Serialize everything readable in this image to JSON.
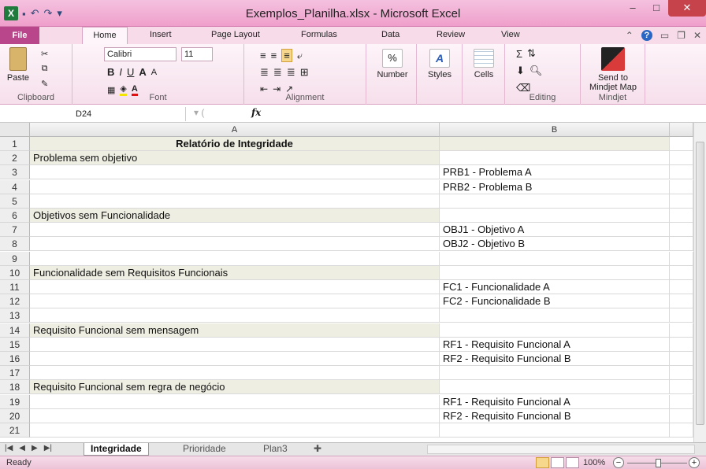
{
  "window": {
    "title": "Exemplos_Planilha.xlsx - Microsoft Excel",
    "app_icon": "X",
    "minimize": "–",
    "maximize": "□",
    "close": "✕"
  },
  "ribbon_tabs": [
    "File",
    "Home",
    "Insert",
    "Page Layout",
    "Formulas",
    "Data",
    "Review",
    "View"
  ],
  "ribbon": {
    "clipboard": {
      "paste": "Paste",
      "label": "Clipboard"
    },
    "font": {
      "name": "Calibri",
      "size": "11",
      "bold": "B",
      "italic": "I",
      "underline": "U",
      "grow": "A",
      "shrink": "A",
      "color": "A",
      "label": "Font"
    },
    "alignment": {
      "label": "Alignment"
    },
    "number": {
      "button": "Number",
      "symbol": "%"
    },
    "styles": {
      "button": "Styles"
    },
    "cells": {
      "button": "Cells"
    },
    "editing": {
      "label": "Editing",
      "sum": "Σ"
    },
    "mindjet": {
      "button_line1": "Send to",
      "button_line2": "Mindjet Map",
      "label": "Mindjet"
    }
  },
  "formula_bar": {
    "name_box": "D24",
    "fx": "fx",
    "content": ""
  },
  "columns": [
    "A",
    "B"
  ],
  "rows": [
    {
      "n": "1",
      "a": "Relatório de Integridade",
      "b": "",
      "type": "title"
    },
    {
      "n": "2",
      "a": "Problema sem objetivo",
      "b": "",
      "type": "section"
    },
    {
      "n": "3",
      "a": "",
      "b": "PRB1 - Problema A",
      "type": "item"
    },
    {
      "n": "4",
      "a": "",
      "b": "PRB2 - Problema B",
      "type": "item"
    },
    {
      "n": "5",
      "a": "",
      "b": "",
      "type": "blank"
    },
    {
      "n": "6",
      "a": "Objetivos sem Funcionalidade",
      "b": "",
      "type": "section"
    },
    {
      "n": "7",
      "a": "",
      "b": "OBJ1 - Objetivo A",
      "type": "item"
    },
    {
      "n": "8",
      "a": "",
      "b": "OBJ2 - Objetivo B",
      "type": "item"
    },
    {
      "n": "9",
      "a": "",
      "b": "",
      "type": "blank"
    },
    {
      "n": "10",
      "a": "Funcionalidade sem Requisitos Funcionais",
      "b": "",
      "type": "section"
    },
    {
      "n": "11",
      "a": "",
      "b": "FC1 - Funcionalidade A",
      "type": "item"
    },
    {
      "n": "12",
      "a": "",
      "b": "FC2 - Funcionalidade B",
      "type": "item"
    },
    {
      "n": "13",
      "a": "",
      "b": "",
      "type": "blank"
    },
    {
      "n": "14",
      "a": "Requisito Funcional sem mensagem",
      "b": "",
      "type": "section"
    },
    {
      "n": "15",
      "a": "",
      "b": "RF1 - Requisito Funcional A",
      "type": "item"
    },
    {
      "n": "16",
      "a": "",
      "b": "RF2 - Requisito Funcional B",
      "type": "item"
    },
    {
      "n": "17",
      "a": "",
      "b": "",
      "type": "blank"
    },
    {
      "n": "18",
      "a": "Requisito Funcional sem regra de negócio",
      "b": "",
      "type": "section"
    },
    {
      "n": "19",
      "a": "",
      "b": "RF1 - Requisito Funcional A",
      "type": "item"
    },
    {
      "n": "20",
      "a": "",
      "b": "RF2 - Requisito Funcional B",
      "type": "item"
    },
    {
      "n": "21",
      "a": "",
      "b": "",
      "type": "blank"
    }
  ],
  "sheet_tabs": [
    "Integridade",
    "Prioridade",
    "Plan3"
  ],
  "active_sheet": "Integridade",
  "status": {
    "text": "Ready",
    "zoom": "100%"
  },
  "colors": {
    "titlebar": "#ef9fcb",
    "file_tab": "#b9458a",
    "section_shade": "#efeee3"
  }
}
